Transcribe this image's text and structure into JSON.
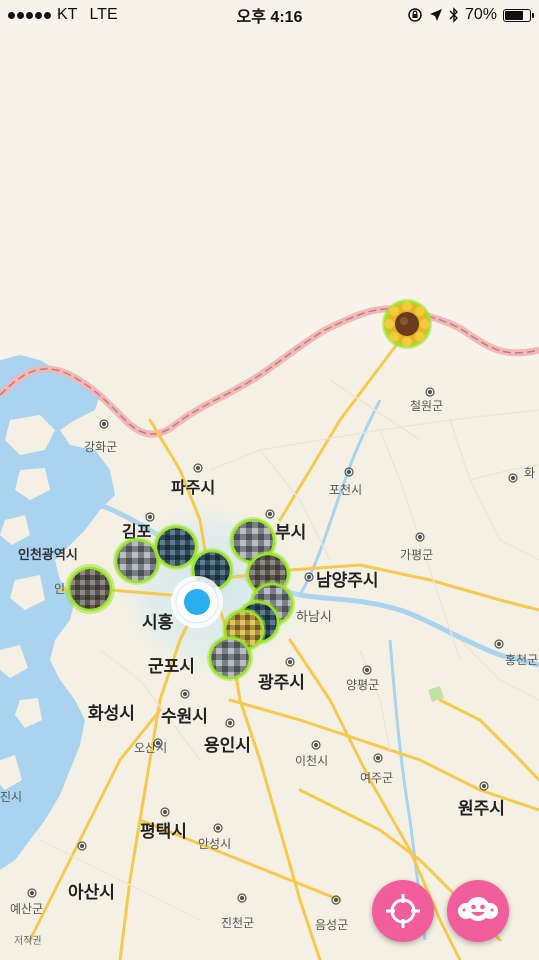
{
  "status_bar": {
    "carrier": "KT",
    "network": "LTE",
    "time": "오후 4:16",
    "battery": "70%"
  },
  "map": {
    "labels": {
      "cheorwon": "철원군",
      "ganghwa": "강화군",
      "paju": "파주시",
      "pocheon": "포천시",
      "gapyeong": "가평군",
      "incheon": "인천광역시",
      "gimpo": "김포",
      "uijeongbu": "부시",
      "namyangju": "남양주시",
      "hanam": "하남시",
      "siheung": "시흥",
      "gunpo": "군포시",
      "gwangju": "광주시",
      "yangpyeong": "양평군",
      "hongcheon": "홍천군",
      "hwaseong": "화성시",
      "suwon": "수원시",
      "yongin": "용인시",
      "osan": "오산시",
      "icheon": "이천시",
      "yeoju": "여주군",
      "wonju": "원주시",
      "pyeongtaek": "평택시",
      "anseong": "안성시",
      "asan": "아산시",
      "yesan": "예산군",
      "jincheon": "진천군",
      "eumseong": "음성군",
      "dangjin": "진시",
      "hwacheon": "화",
      "incheon_partial": "인",
      "copyright": "저작권"
    },
    "accent_color": "#f25d9c",
    "marker_border_color": "#9be22a",
    "user_location_color": "#29aef0"
  },
  "buttons": {
    "locate": "locate-crosshair-icon",
    "friends": "friends-face-icon"
  }
}
